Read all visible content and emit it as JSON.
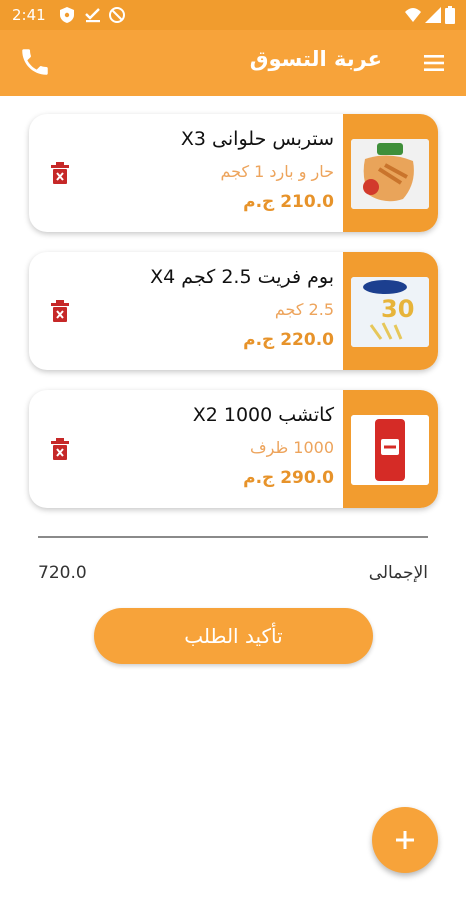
{
  "status_bar": {
    "time": "2:41",
    "icons": [
      "shield-icon",
      "check-icon",
      "no-sim-icon",
      "wifi-icon",
      "signal-icon",
      "battery-icon"
    ]
  },
  "app_bar": {
    "title": "عربة التسوق",
    "menu_icon": "menu-icon",
    "call_icon": "phone-icon"
  },
  "cart": {
    "items": [
      {
        "name": "ستربس حلوانى X3",
        "detail": "حار و بارد 1 كجم",
        "price": "210.0 ج.م",
        "image_icon": "fried-chicken-bag-icon",
        "delete_icon": "trash-icon"
      },
      {
        "name": "بوم فريت 2.5 كجم X4",
        "detail": "2.5 كجم",
        "price": "220.0 ج.م",
        "image_icon": "fries-bag-icon",
        "delete_icon": "trash-icon"
      },
      {
        "name": "كاتشب 1000 X2",
        "detail": "1000 ظرف",
        "price": "290.0 ج.م",
        "image_icon": "ketchup-sachet-icon",
        "delete_icon": "trash-icon"
      }
    ]
  },
  "summary": {
    "total_label": "الإجمالى",
    "total_value": "720.0"
  },
  "confirm_button": {
    "label": "تأكيد الطلب"
  },
  "fab": {
    "icon": "plus-icon"
  },
  "colors": {
    "primary": "#f7a33a",
    "status_bar": "#f19c2e",
    "image_panel": "#f29c2f",
    "detail_text": "#eda45c",
    "price_text": "#e7932a",
    "delete_icon": "#c62828"
  }
}
